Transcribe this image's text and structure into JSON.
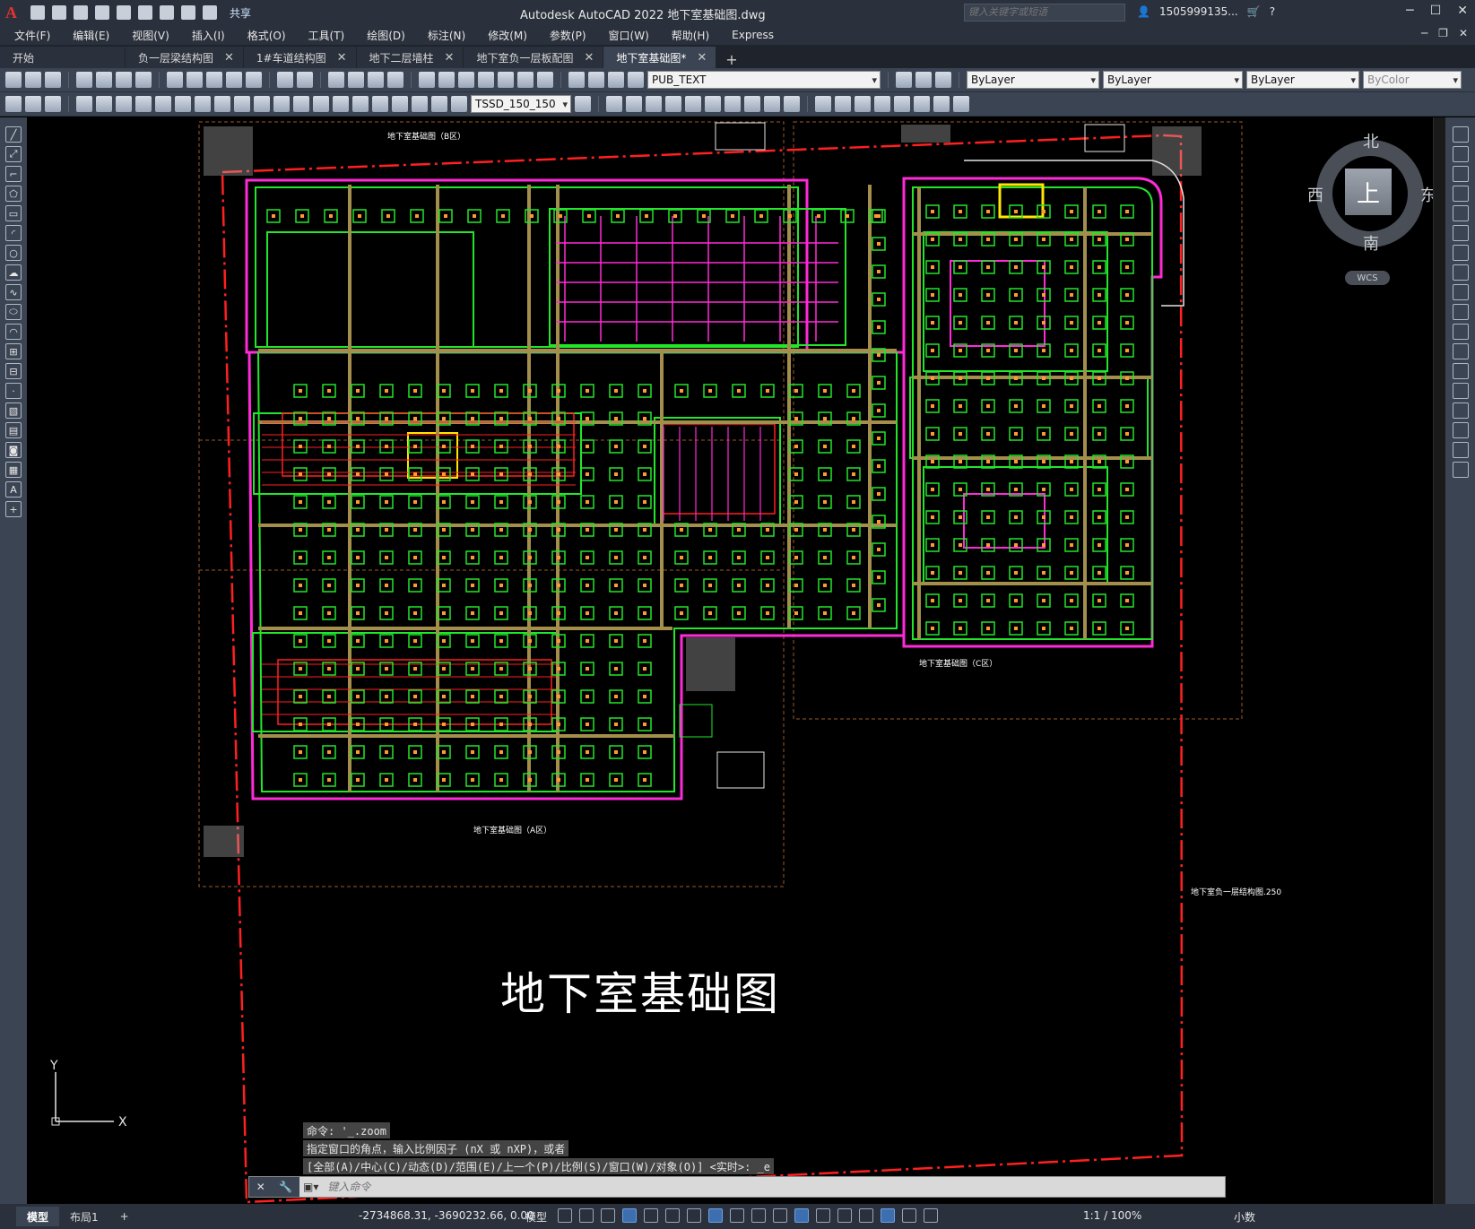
{
  "app": {
    "title": "Autodesk AutoCAD 2022    地下室基础图.dwg",
    "share_label": "共享",
    "search_placeholder": "键入关键字或短语",
    "user": "1505999135...",
    "logo": "A"
  },
  "menu": [
    "文件(F)",
    "编辑(E)",
    "视图(V)",
    "插入(I)",
    "格式(O)",
    "工具(T)",
    "绘图(D)",
    "标注(N)",
    "修改(M)",
    "参数(P)",
    "窗口(W)",
    "帮助(H)",
    "Express"
  ],
  "tabs": [
    {
      "label": "开始",
      "closable": false
    },
    {
      "label": "负一层梁结构图",
      "closable": true
    },
    {
      "label": "1#车道结构图",
      "closable": true
    },
    {
      "label": "地下二层墙柱",
      "closable": true
    },
    {
      "label": "地下室负一层板配图",
      "closable": true
    },
    {
      "label": "地下室基础图*",
      "closable": true,
      "active": true
    }
  ],
  "toolbar1": {
    "layer": "PUB_TEXT",
    "color": "ByLayer",
    "linetype": "ByLayer",
    "lineweight": "ByLayer",
    "plotstyle": "ByColor"
  },
  "toolbar2": {
    "style": "TSSD_150_150"
  },
  "viewcube": {
    "north": "北",
    "south": "南",
    "west": "西",
    "east": "东",
    "face": "上",
    "wcs": "WCS"
  },
  "drawing": {
    "main_title": "地下室基础图",
    "label_b": "地下室基础图（B区）",
    "label_c": "地下室基础图（C区）",
    "label_a": "地下室基础图（A区）",
    "label_side": "地下室负一层结构图.250",
    "ucs_x": "X",
    "ucs_y": "Y"
  },
  "command": {
    "history": [
      "命令: '_.zoom",
      "指定窗口的角点，输入比例因子 (nX 或 nXP)，或者",
      "[全部(A)/中心(C)/动态(D)/范围(E)/上一个(P)/比例(S)/窗口(W)/对象(O)] <实时>: _e"
    ],
    "placeholder": "键入命令"
  },
  "status": {
    "layout_tabs": [
      "模型",
      "布局1"
    ],
    "coords": "-2734868.31, -3690232.66, 0.00",
    "mode": "模型",
    "scale": "1:1 / 100%",
    "units": "小数"
  },
  "colors": {
    "green": "#22e62a",
    "magenta": "#ff2ad8",
    "red": "#ff2020",
    "olive": "#a38f4b",
    "brown": "#9a5a2a",
    "yellow": "#ffe600",
    "white": "#ffffff"
  }
}
